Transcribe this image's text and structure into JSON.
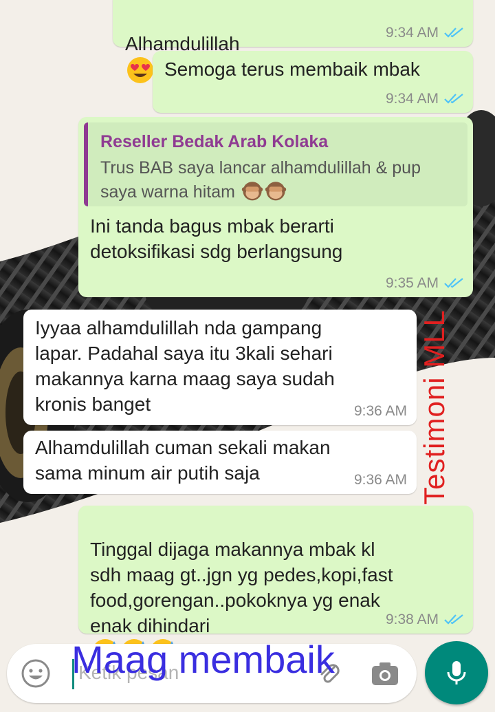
{
  "chat": {
    "messages": [
      {
        "text": "Alhamdulillah",
        "time": "9:34 AM"
      },
      {
        "text": "Semoga terus membaik mbak",
        "time": "9:34 AM"
      },
      {
        "quote_name": "Reseller Bedak Arab Kolaka",
        "quote_text": "Trus BAB saya lancar alhamdulillah & pup\nsaya warna hitam",
        "text": "Ini tanda bagus mbak berarti\ndetoksifikasi sdg berlangsung",
        "time": "9:35 AM"
      },
      {
        "text": "Iyyaa alhamdulillah nda gampang\nlapar. Padahal saya itu 3kali sehari\nmakannya karna maag saya sudah\nkronis banget",
        "time": "9:36 AM"
      },
      {
        "text": "Alhamdulillah cuman sekali makan\nsama minum air putih saja",
        "time": "9:36 AM"
      },
      {
        "text": "Tinggal dijaga makannya mbak kl\nsdh maag gt..jgn yg pedes,kopi,fast\nfood,gorengan..pokoknya yg enak\nenak dihindari",
        "time": "9:38 AM"
      }
    ]
  },
  "input": {
    "placeholder": "Ketik pesan"
  },
  "overlay": {
    "watermark": "Testimoni MLL",
    "caption": "Maag membaik"
  },
  "colors": {
    "outgoing": "#dcf8c6",
    "incoming": "#ffffff",
    "read_ticks": "#4fc3f7",
    "quote_accent": "#8f3b92",
    "mic_button": "#00897b"
  },
  "icons": [
    "heart-eyes-emoji",
    "see-no-evil-monkey-emoji",
    "sweat-smile-emoji",
    "double-check-icon",
    "emoji-smiley-icon",
    "attach-icon",
    "camera-icon",
    "mic-icon"
  ]
}
